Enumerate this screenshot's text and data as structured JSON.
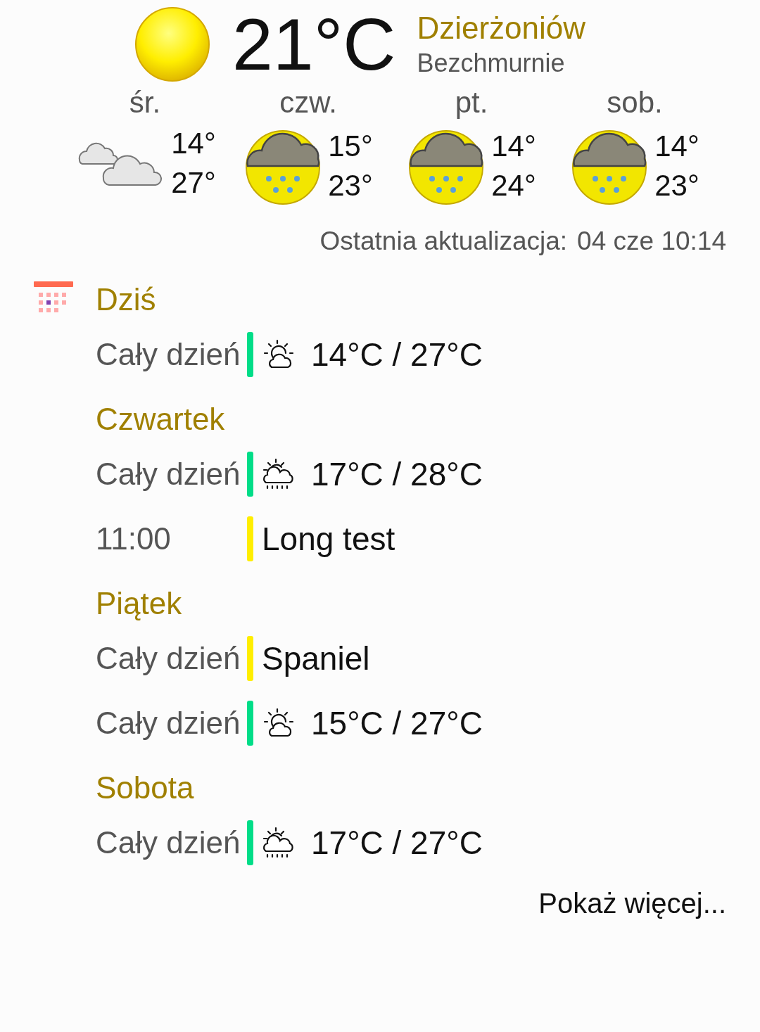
{
  "current": {
    "temperature": "21°C",
    "city": "Dzierżoniów",
    "condition": "Bezchmurnie"
  },
  "forecast": [
    {
      "day": "śr.",
      "kind": "cloudy",
      "low": "14°",
      "high": "27°"
    },
    {
      "day": "czw.",
      "kind": "rain",
      "low": "15°",
      "high": "23°"
    },
    {
      "day": "pt.",
      "kind": "rain",
      "low": "14°",
      "high": "24°"
    },
    {
      "day": "sob.",
      "kind": "rain",
      "low": "14°",
      "high": "23°"
    }
  ],
  "last_update": {
    "label": "Ostatnia aktualizacja:",
    "value": "04 cze 10:14"
  },
  "agenda": [
    {
      "day": "Dziś",
      "events": [
        {
          "time": "Cały dzień",
          "kind": "sunny",
          "color": "#00dd88",
          "text": "14°C / 27°C"
        }
      ]
    },
    {
      "day": "Czwartek",
      "events": [
        {
          "time": "Cały dzień",
          "kind": "rainy",
          "color": "#00dd88",
          "text": "17°C / 28°C"
        },
        {
          "time": "11:00",
          "kind": "event",
          "color": "#ffee00",
          "text": "Long test"
        }
      ]
    },
    {
      "day": "Piątek",
      "events": [
        {
          "time": "Cały dzień",
          "kind": "event",
          "color": "#ffee00",
          "text": "Spaniel"
        },
        {
          "time": "Cały dzień",
          "kind": "sunny",
          "color": "#00dd88",
          "text": "15°C / 27°C"
        }
      ]
    },
    {
      "day": "Sobota",
      "events": [
        {
          "time": "Cały dzień",
          "kind": "rainy",
          "color": "#00dd88",
          "text": "17°C / 27°C"
        }
      ]
    }
  ],
  "more_link": "Pokaż więcej..."
}
